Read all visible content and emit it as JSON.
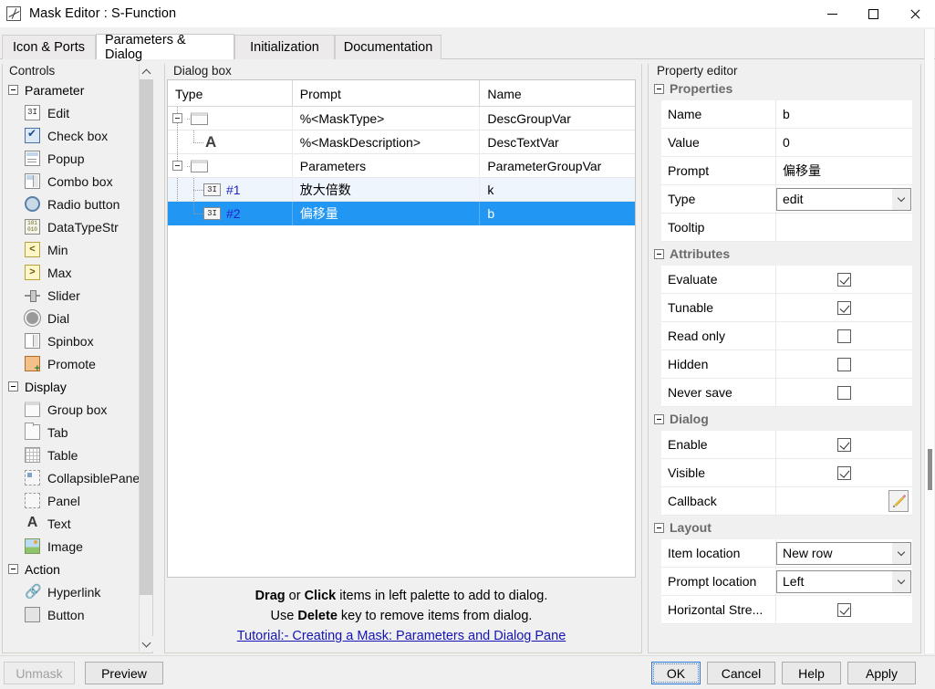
{
  "window": {
    "title": "Mask Editor : S-Function",
    "icon": "mask-editor-icon",
    "minimize_label": "–",
    "maximize_label": "□",
    "close_label": "×"
  },
  "tabs": [
    {
      "label": "Icon & Ports",
      "active": false
    },
    {
      "label": "Parameters & Dialog",
      "active": true
    },
    {
      "label": "Initialization",
      "active": false
    },
    {
      "label": "Documentation",
      "active": false
    }
  ],
  "palette": {
    "legend": "Controls",
    "groups": [
      {
        "label": "Parameter",
        "items": [
          {
            "label": "Edit",
            "icon": "edit-icon"
          },
          {
            "label": "Check box",
            "icon": "check-box-icon"
          },
          {
            "label": "Popup",
            "icon": "popup-icon"
          },
          {
            "label": "Combo box",
            "icon": "combo-box-icon"
          },
          {
            "label": "Radio button",
            "icon": "radio-button-icon"
          },
          {
            "label": "DataTypeStr",
            "icon": "data-type-str-icon"
          },
          {
            "label": "Min",
            "icon": "min-icon"
          },
          {
            "label": "Max",
            "icon": "max-icon"
          },
          {
            "label": "Slider",
            "icon": "slider-icon"
          },
          {
            "label": "Dial",
            "icon": "dial-icon"
          },
          {
            "label": "Spinbox",
            "icon": "spinbox-icon"
          },
          {
            "label": "Promote",
            "icon": "promote-icon"
          }
        ]
      },
      {
        "label": "Display",
        "items": [
          {
            "label": "Group box",
            "icon": "group-box-icon"
          },
          {
            "label": "Tab",
            "icon": "tab-icon"
          },
          {
            "label": "Table",
            "icon": "table-icon"
          },
          {
            "label": "CollapsiblePanel",
            "icon": "collapsible-panel-icon"
          },
          {
            "label": "Panel",
            "icon": "panel-icon"
          },
          {
            "label": "Text",
            "icon": "text-icon"
          },
          {
            "label": "Image",
            "icon": "image-icon"
          }
        ]
      },
      {
        "label": "Action",
        "items": [
          {
            "label": "Hyperlink",
            "icon": "hyperlink-icon"
          },
          {
            "label": "Button",
            "icon": "button-icon"
          }
        ]
      }
    ]
  },
  "dialog_box": {
    "legend": "Dialog box",
    "columns": [
      "Type",
      "Prompt",
      "Name"
    ],
    "rows": [
      {
        "type_icon": "group-box-icon",
        "num": "",
        "prompt": "%<MaskType>",
        "name": "DescGroupVar",
        "indent": 0,
        "expandable": true,
        "state": "normal"
      },
      {
        "type_icon": "text-icon",
        "num": "",
        "prompt": "%<MaskDescription>",
        "name": "DescTextVar",
        "indent": 1,
        "expandable": false,
        "state": "normal"
      },
      {
        "type_icon": "group-box-icon",
        "num": "",
        "prompt": "Parameters",
        "name": "ParameterGroupVar",
        "indent": 0,
        "expandable": true,
        "state": "normal"
      },
      {
        "type_icon": "edit-icon",
        "num": "#1",
        "prompt": "放大倍数",
        "name": "k",
        "indent": 1,
        "expandable": false,
        "state": "alt"
      },
      {
        "type_icon": "edit-icon",
        "num": "#2",
        "prompt": "偏移量",
        "name": "b",
        "indent": 1,
        "expandable": false,
        "state": "selected"
      }
    ],
    "instructions": {
      "line1_bold1": "Drag",
      "line1_mid": " or ",
      "line1_bold2": "Click",
      "line1_rest": " items in left palette to add to dialog.",
      "line2_pre": "Use ",
      "line2_bold": "Delete",
      "line2_rest": " key to remove items from dialog.",
      "link": "Tutorial:- Creating a Mask: Parameters and Dialog Pane"
    }
  },
  "property_editor": {
    "legend": "Property editor",
    "sections": [
      {
        "title": "Properties",
        "rows": [
          {
            "key": "Name",
            "value": "b",
            "kind": "text"
          },
          {
            "key": "Value",
            "value": "0",
            "kind": "text"
          },
          {
            "key": "Prompt",
            "value": "偏移量",
            "kind": "text"
          },
          {
            "key": "Type",
            "value": "edit",
            "kind": "combo"
          },
          {
            "key": "Tooltip",
            "value": "",
            "kind": "text"
          }
        ]
      },
      {
        "title": "Attributes",
        "rows": [
          {
            "key": "Evaluate",
            "value": "checked",
            "kind": "checkbox"
          },
          {
            "key": "Tunable",
            "value": "checked",
            "kind": "checkbox"
          },
          {
            "key": "Read only",
            "value": "unchecked",
            "kind": "checkbox"
          },
          {
            "key": "Hidden",
            "value": "unchecked",
            "kind": "checkbox"
          },
          {
            "key": "Never save",
            "value": "unchecked",
            "kind": "checkbox"
          }
        ]
      },
      {
        "title": "Dialog",
        "rows": [
          {
            "key": "Enable",
            "value": "checked",
            "kind": "checkbox"
          },
          {
            "key": "Visible",
            "value": "checked",
            "kind": "checkbox"
          },
          {
            "key": "Callback",
            "value": "",
            "kind": "pencil"
          }
        ]
      },
      {
        "title": "Layout",
        "rows": [
          {
            "key": "Item location",
            "value": "New row",
            "kind": "combo"
          },
          {
            "key": "Prompt location",
            "value": "Left",
            "kind": "combo"
          },
          {
            "key": "Horizontal Stre...",
            "value": "checked",
            "kind": "checkbox"
          }
        ]
      }
    ]
  },
  "footer": {
    "unmask": "Unmask",
    "preview": "Preview",
    "ok": "OK",
    "cancel": "Cancel",
    "help": "Help",
    "apply": "Apply"
  },
  "colors": {
    "selection_blue": "#2196f3",
    "alt_row": "#eff5fd",
    "link": "#1414b4",
    "hash_number": "#2323c8",
    "section_header": "#6b6b6b"
  }
}
